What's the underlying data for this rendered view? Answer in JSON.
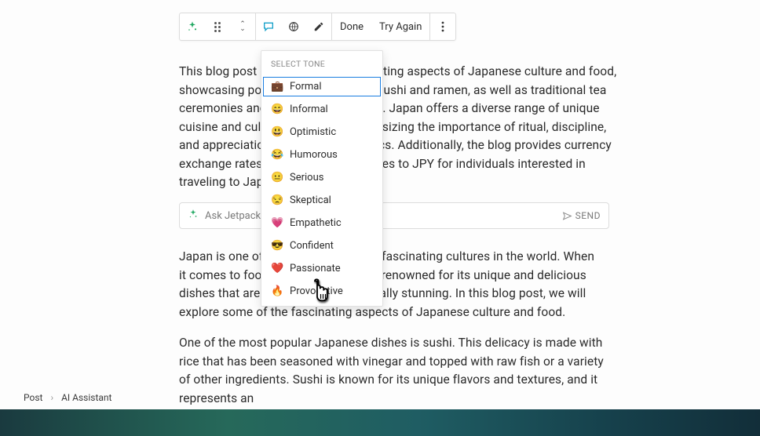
{
  "toolbar": {
    "done_label": "Done",
    "try_again_label": "Try Again"
  },
  "dropdown": {
    "header": "SELECT TONE",
    "selected_index": 0,
    "items": [
      {
        "emoji": "💼",
        "label": "Formal"
      },
      {
        "emoji": "😄",
        "label": "Informal"
      },
      {
        "emoji": "😃",
        "label": "Optimistic"
      },
      {
        "emoji": "😂",
        "label": "Humorous"
      },
      {
        "emoji": "😐",
        "label": "Serious"
      },
      {
        "emoji": "😒",
        "label": "Skeptical"
      },
      {
        "emoji": "💗",
        "label": "Empathetic"
      },
      {
        "emoji": "😎",
        "label": "Confident"
      },
      {
        "emoji": "❤️",
        "label": "Passionate"
      },
      {
        "emoji": "🔥",
        "label": "Provocative"
      }
    ]
  },
  "paragraphs": {
    "p1": "This blog post delves into the fascinating aspects of Japanese culture and food, showcasing popular dishes such as sushi and ramen, as well as traditional tea ceremonies and festivals like Matsuri. Japan offers a diverse range of unique cuisine and cultural practices, emphasizing the importance of ritual, discipline, and appreciation for art and aesthetics. Additionally, the blog provides currency exchange rates from various currencies to JPY for individuals interested in traveling to Japan.",
    "p2": "Japan is one of the most unique and fascinating cultures in the world. When it comes to food, Japan is especially renowned for its unique and delicious dishes that are both healthy and visually stunning. In this blog post, we will explore some of the fascinating aspects of Japanese culture and food.",
    "p3": "One of the most popular Japanese dishes is sushi. This delicacy is made with rice that has been seasoned with vinegar and topped with raw fish or a variety of other ingredients. Sushi is known for its unique flavors and textures, and it represents an"
  },
  "ask_bar": {
    "placeholder": "Ask Jetpack AI",
    "send_label": "SEND"
  },
  "breadcrumb": {
    "item1": "Post",
    "item2": "AI Assistant"
  }
}
